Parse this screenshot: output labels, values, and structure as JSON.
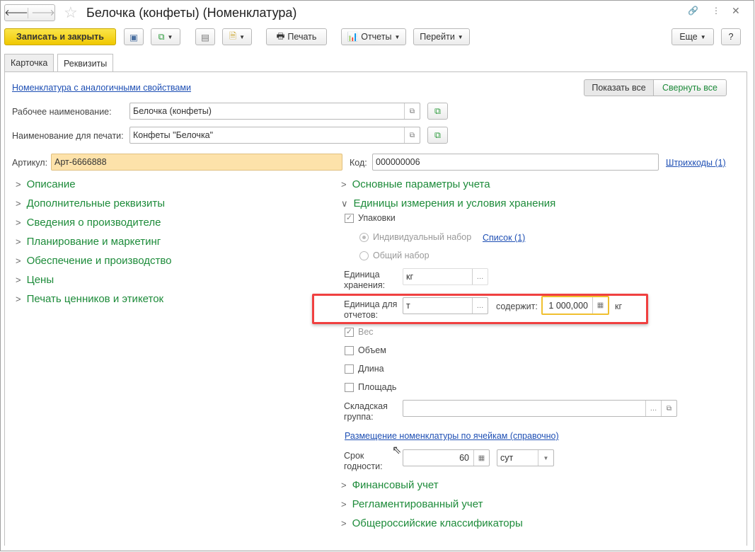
{
  "window": {
    "title": "Белочка (конфеты) (Номенклатура)"
  },
  "toolbar": {
    "save_close": "Записать и закрыть",
    "print": "Печать",
    "reports": "Отчеты",
    "goto": "Перейти",
    "more": "Еще",
    "help": "?"
  },
  "tabs": [
    {
      "label": "Карточка"
    },
    {
      "label": "Реквизиты"
    }
  ],
  "similar_link": "Номенклатура с аналогичными свойствами",
  "show_all": "Показать все",
  "collapse_all": "Свернуть все",
  "fields": {
    "work_name": {
      "label": "Рабочее наименование:",
      "value": "Белочка (конфеты)"
    },
    "print_name": {
      "label": "Наименование для печати:",
      "value": "Конфеты \"Белочка\""
    },
    "article": {
      "label": "Артикул:",
      "value": "Арт-6666888"
    },
    "code": {
      "label": "Код:",
      "value": "000000006"
    },
    "barcodes": "Штрихкоды (1)"
  },
  "left_groups": [
    "Описание",
    "Дополнительные реквизиты",
    "Сведения о производителе",
    "Планирование и маркетинг",
    "Обеспечение и производство",
    "Цены",
    "Печать ценников и этикеток"
  ],
  "right": {
    "basic": "Основные параметры учета",
    "units": "Единицы измерения и условия хранения",
    "packages": "Упаковки",
    "individual": "Индивидуальный набор",
    "list_link": "Список (1)",
    "common": "Общий набор",
    "storage_unit_label1": "Единица",
    "storage_unit_label2": "хранения:",
    "storage_unit": "кг",
    "report_unit_label1": "Единица для",
    "report_unit_label2": "отчетов:",
    "report_unit": "т",
    "contains": "содержит:",
    "contains_value": "1 000,000",
    "contains_unit": "кг",
    "weight": "Вес",
    "volume": "Объем",
    "length": "Длина",
    "area": "Площадь",
    "wh_group_label1": "Складская",
    "wh_group_label2": "группа:",
    "wh_group": "",
    "placement_link": "Размещение номенклатуры по ячейкам (справочно)",
    "shelf_label1": "Срок",
    "shelf_label2": "годности:",
    "shelf_value": "60",
    "shelf_unit": "сут",
    "financial": "Финансовый учет",
    "regulated": "Регламентированный учет",
    "classifiers": "Общероссийские классификаторы"
  },
  "colors": {
    "accent": "#f0c800",
    "group": "#1d8b3a",
    "highlight": "#f04040",
    "link": "#1e4fb4"
  }
}
